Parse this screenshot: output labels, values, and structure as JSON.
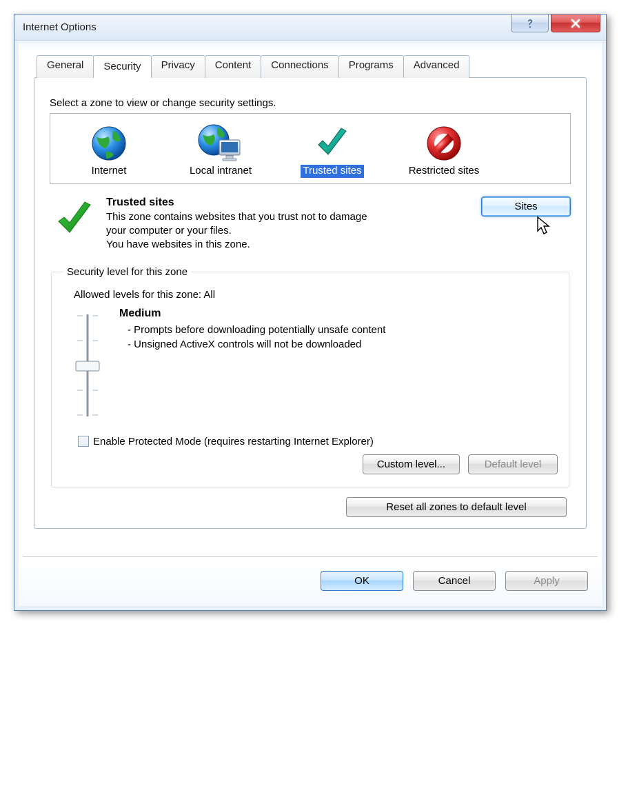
{
  "window": {
    "title": "Internet Options"
  },
  "tabs": {
    "general": "General",
    "security": "Security",
    "privacy": "Privacy",
    "content": "Content",
    "connections": "Connections",
    "programs": "Programs",
    "advanced": "Advanced",
    "active": "security"
  },
  "zones": {
    "instruction": "Select a zone to view or change security settings.",
    "items": [
      {
        "label": "Internet",
        "icon": "globe"
      },
      {
        "label": "Local intranet",
        "icon": "globe-monitor"
      },
      {
        "label": "Trusted sites",
        "icon": "checkmark",
        "selected": true
      },
      {
        "label": "Restricted sites",
        "icon": "no-entry"
      }
    ]
  },
  "zone_detail": {
    "title": "Trusted sites",
    "description": "This zone contains websites that you trust not to damage your computer or your files.",
    "status": "You have websites in this zone.",
    "sites_button": "Sites"
  },
  "security_level": {
    "group_label": "Security level for this zone",
    "allowed": "Allowed levels for this zone: All",
    "level_name": "Medium",
    "bullet1": "- Prompts before downloading potentially unsafe content",
    "bullet2": "- Unsigned ActiveX controls will not be downloaded",
    "protected_mode": "Enable Protected Mode (requires restarting Internet Explorer)",
    "protected_mode_checked": false,
    "custom_level": "Custom level...",
    "default_level": "Default level",
    "reset_all": "Reset all zones to default level"
  },
  "footer": {
    "ok": "OK",
    "cancel": "Cancel",
    "apply": "Apply"
  }
}
